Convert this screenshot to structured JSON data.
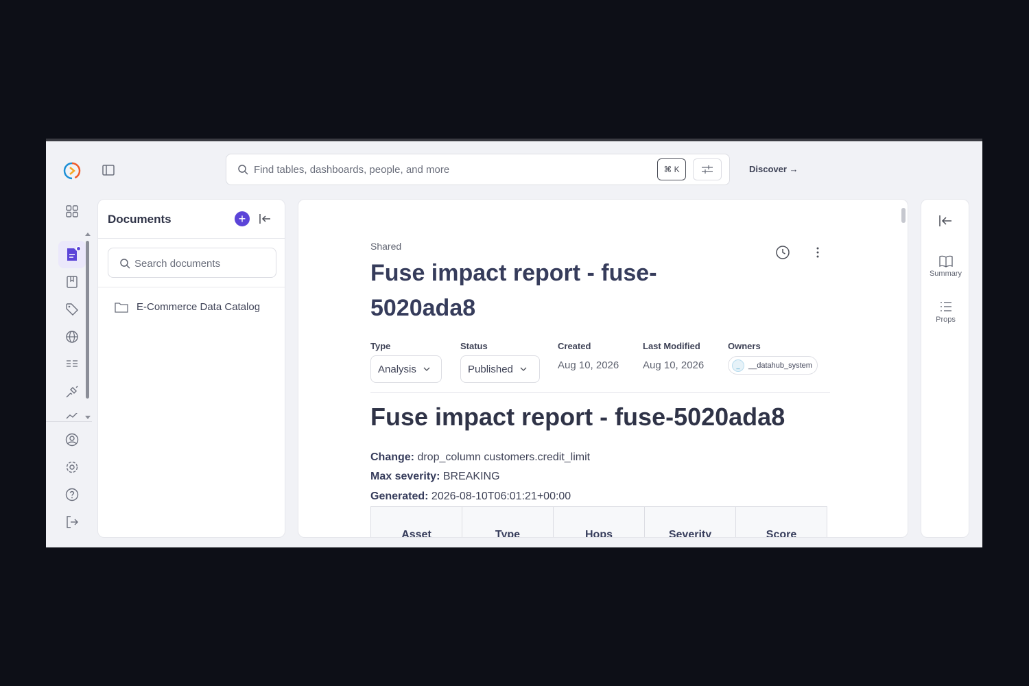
{
  "search": {
    "placeholder": "Find tables, dashboards, people, and more",
    "shortcut": "⌘ K"
  },
  "header": {
    "discover_label": "Discover →"
  },
  "documents_panel": {
    "title": "Documents",
    "add_label": "+",
    "search_placeholder": "Search documents",
    "folders": [
      {
        "label": "E-Commerce Data Catalog"
      }
    ]
  },
  "document": {
    "breadcrumb": "Shared",
    "title": "Fuse impact report - fuse-5020ada8",
    "meta": {
      "type_label": "Type",
      "type_value": "Analysis",
      "status_label": "Status",
      "status_value": "Published",
      "created_label": "Created",
      "created_value": "Aug 10, 2026",
      "modified_label": "Last Modified",
      "modified_value": "Aug 10, 2026",
      "owners_label": "Owners",
      "owner_initial": "_",
      "owner_name": "__datahub_system"
    },
    "body": {
      "heading": "Fuse impact report - fuse-5020ada8",
      "change_label": "Change:",
      "change_value": "drop_column customers.credit_limit",
      "severity_label": "Max severity:",
      "severity_value": "BREAKING",
      "generated_label": "Generated:",
      "generated_value": "2026-08-10T06:01:21+00:00",
      "table_headers": [
        "Asset",
        "Type",
        "Hops",
        "Severity",
        "Score"
      ]
    }
  },
  "right_panel": {
    "summary_label": "Summary",
    "props_label": "Props"
  },
  "colors": {
    "accent": "#5b44d8",
    "title": "#363c5b",
    "background": "#f1f2f6"
  }
}
